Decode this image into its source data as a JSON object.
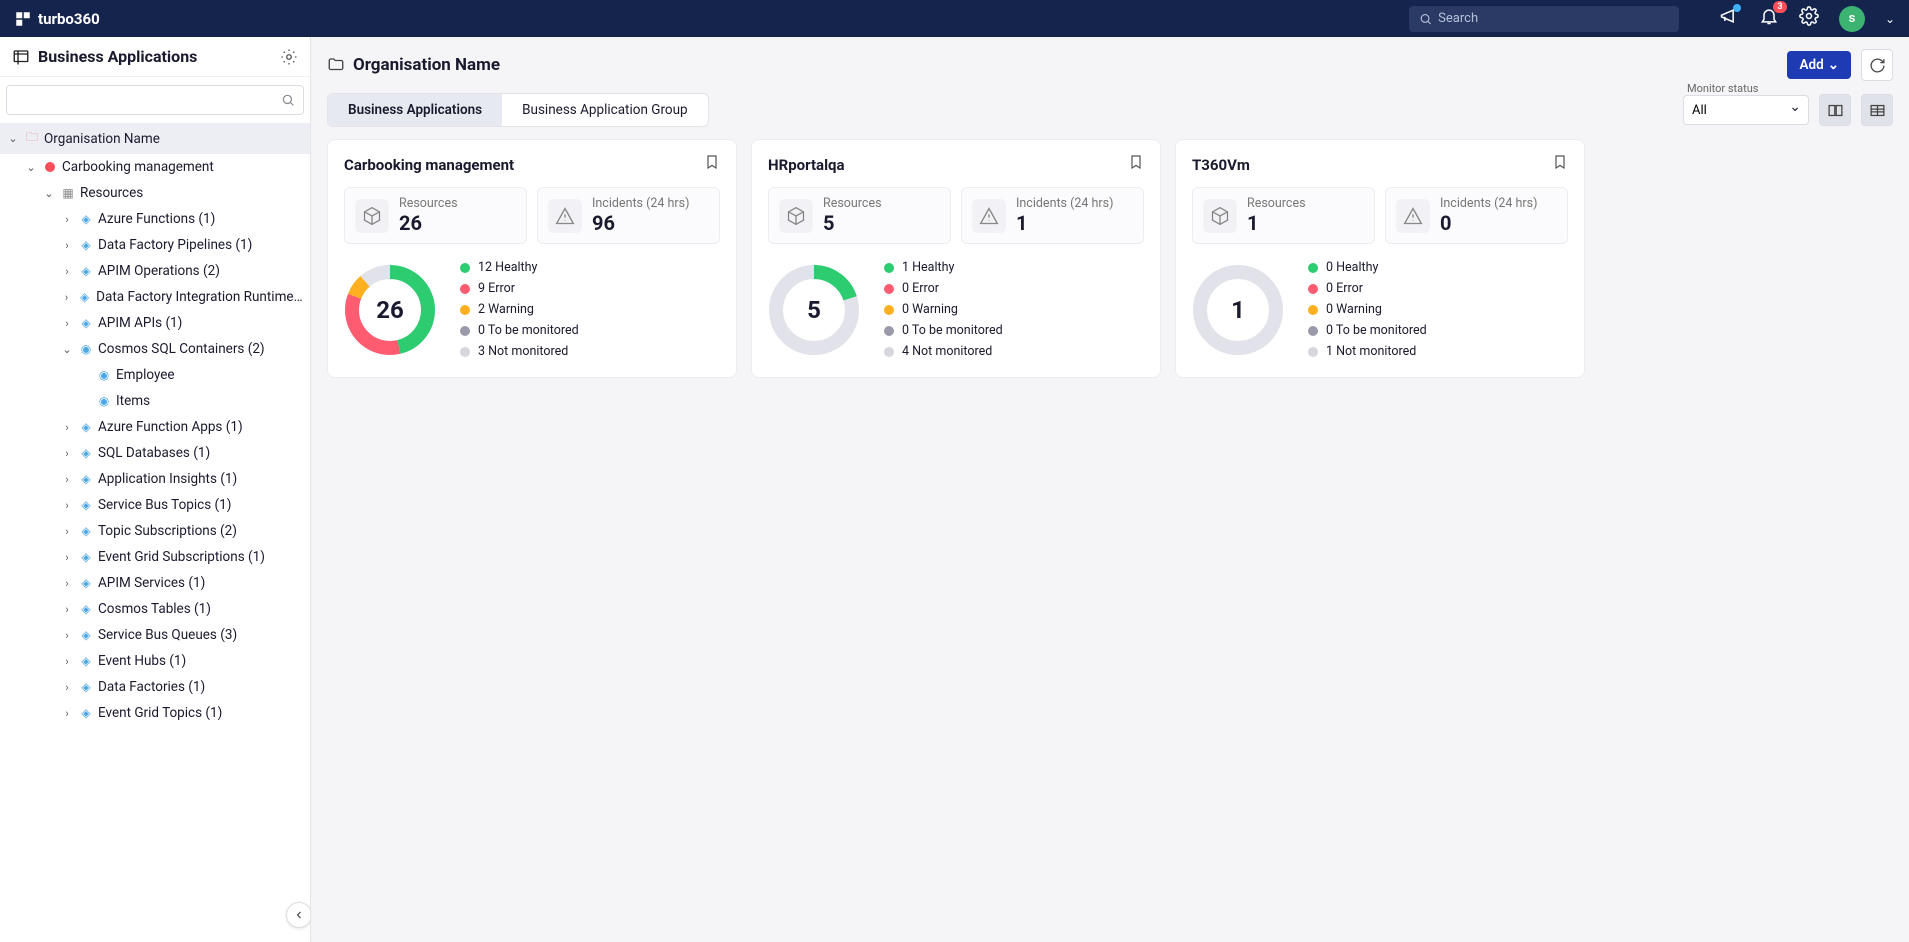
{
  "header": {
    "brand": "turbo360",
    "search_placeholder": "Search",
    "notif_count": "3",
    "avatar_letter": "s"
  },
  "sidebar": {
    "title": "Business Applications",
    "org_label": "Organisation Name",
    "carbooking_label": "Carbooking management",
    "resources_label": "Resources",
    "items": [
      {
        "label": "Azure Functions (1)"
      },
      {
        "label": "Data Factory Pipelines (1)"
      },
      {
        "label": "APIM Operations (2)"
      },
      {
        "label": "Data Factory Integration Runtimes (…"
      },
      {
        "label": "APIM APIs (1)"
      }
    ],
    "cosmos_label": "Cosmos SQL Containers (2)",
    "cosmos_children": [
      {
        "label": "Employee"
      },
      {
        "label": "Items"
      }
    ],
    "items_after": [
      {
        "label": "Azure Function Apps (1)"
      },
      {
        "label": "SQL Databases (1)"
      },
      {
        "label": "Application Insights (1)"
      },
      {
        "label": "Service Bus Topics (1)"
      },
      {
        "label": "Topic Subscriptions (2)"
      },
      {
        "label": "Event Grid Subscriptions (1)"
      },
      {
        "label": "APIM Services (1)"
      },
      {
        "label": "Cosmos Tables (1)"
      },
      {
        "label": "Service Bus Queues (3)"
      },
      {
        "label": "Event Hubs (1)"
      },
      {
        "label": "Data Factories (1)"
      },
      {
        "label": "Event Grid Topics (1)"
      }
    ]
  },
  "main": {
    "breadcrumb": "Organisation Name",
    "add_label": "Add",
    "tabs": {
      "t1": "Business Applications",
      "t2": "Business Application Group"
    },
    "filter_label": "Monitor status",
    "filter_value": "All"
  },
  "cards": [
    {
      "title": "Carbooking management",
      "resources_label": "Resources",
      "resources_value": "26",
      "incidents_label": "Incidents (24 hrs)",
      "incidents_value": "96",
      "chart_data": {
        "type": "pie",
        "healthy": 12,
        "error": 9,
        "warning": 2,
        "tbm": 0,
        "nm": 3,
        "total": 26
      },
      "legend": {
        "healthy": "12 Healthy",
        "error": "9 Error",
        "warning": "2 Warning",
        "tbm": "0 To be monitored",
        "nm": "3 Not monitored"
      }
    },
    {
      "title": "HRportalqa",
      "resources_label": "Resources",
      "resources_value": "5",
      "incidents_label": "Incidents (24 hrs)",
      "incidents_value": "1",
      "chart_data": {
        "type": "pie",
        "healthy": 1,
        "error": 0,
        "warning": 0,
        "tbm": 0,
        "nm": 4,
        "total": 5
      },
      "legend": {
        "healthy": "1 Healthy",
        "error": "0 Error",
        "warning": "0 Warning",
        "tbm": "0 To be monitored",
        "nm": "4 Not monitored"
      }
    },
    {
      "title": "T360Vm",
      "resources_label": "Resources",
      "resources_value": "1",
      "incidents_label": "Incidents (24 hrs)",
      "incidents_value": "0",
      "chart_data": {
        "type": "pie",
        "healthy": 0,
        "error": 0,
        "warning": 0,
        "tbm": 0,
        "nm": 1,
        "total": 1
      },
      "legend": {
        "healthy": "0 Healthy",
        "error": "0 Error",
        "warning": "0 Warning",
        "tbm": "0 To be monitored",
        "nm": "1 Not monitored"
      }
    }
  ]
}
